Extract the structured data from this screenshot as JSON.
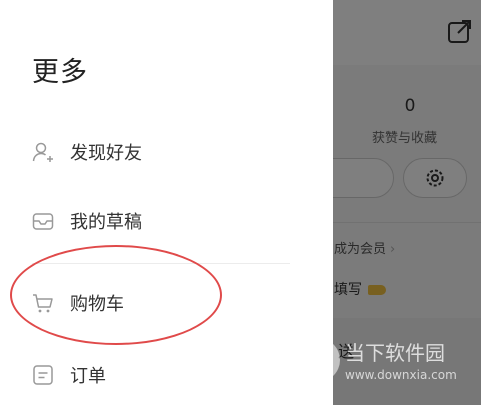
{
  "background_page": {
    "stat_value": "0",
    "stat_label": "获赞与收藏",
    "become_member": "成为会员",
    "fill_in": "填写",
    "lower_text": "送",
    "icons": [
      "share-icon",
      "gear-icon",
      "hand-pointer-icon"
    ]
  },
  "drawer": {
    "title": "更多",
    "items": [
      {
        "label": "发现好友",
        "icon": "add-user-icon"
      },
      {
        "label": "我的草稿",
        "icon": "draft-tray-icon"
      },
      {
        "label": "购物车",
        "icon": "shopping-cart-icon"
      },
      {
        "label": "订单",
        "icon": "order-list-icon"
      }
    ]
  },
  "annotation": {
    "color": "#e04a4a"
  },
  "watermark": {
    "text": "当下软件园",
    "url": "www.downxia.com"
  }
}
